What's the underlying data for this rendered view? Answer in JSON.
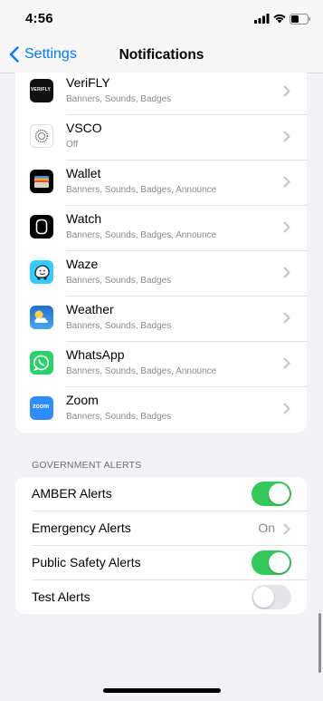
{
  "status_bar": {
    "time": "4:56"
  },
  "nav": {
    "back_label": "Settings",
    "title": "Notifications"
  },
  "apps": [
    {
      "name": "VeriFLY",
      "detail": "Banners, Sounds, Badges",
      "icon": "verifly-icon"
    },
    {
      "name": "VSCO",
      "detail": "Off",
      "icon": "vsco-icon"
    },
    {
      "name": "Wallet",
      "detail": "Banners, Sounds, Badges, Announce",
      "icon": "wallet-icon"
    },
    {
      "name": "Watch",
      "detail": "Banners, Sounds, Badges, Announce",
      "icon": "watch-icon"
    },
    {
      "name": "Waze",
      "detail": "Banners, Sounds, Badges",
      "icon": "waze-icon"
    },
    {
      "name": "Weather",
      "detail": "Banners, Sounds, Badges",
      "icon": "weather-icon"
    },
    {
      "name": "WhatsApp",
      "detail": "Banners, Sounds, Badges, Announce",
      "icon": "whatsapp-icon"
    },
    {
      "name": "Zoom",
      "detail": "Banners, Sounds, Badges",
      "icon": "zoom-icon"
    }
  ],
  "icon_text": {
    "verifly": "VERIFLY",
    "zoom": "zoom"
  },
  "government_alerts": {
    "header": "GOVERNMENT ALERTS",
    "items": [
      {
        "label": "AMBER Alerts",
        "toggle": true
      },
      {
        "label": "Emergency Alerts",
        "value": "On"
      },
      {
        "label": "Public Safety Alerts",
        "toggle": true
      },
      {
        "label": "Test Alerts",
        "toggle": false
      }
    ]
  },
  "colors": {
    "accent": "#007aff",
    "toggle_on": "#34c759",
    "background": "#f2f2f7"
  }
}
